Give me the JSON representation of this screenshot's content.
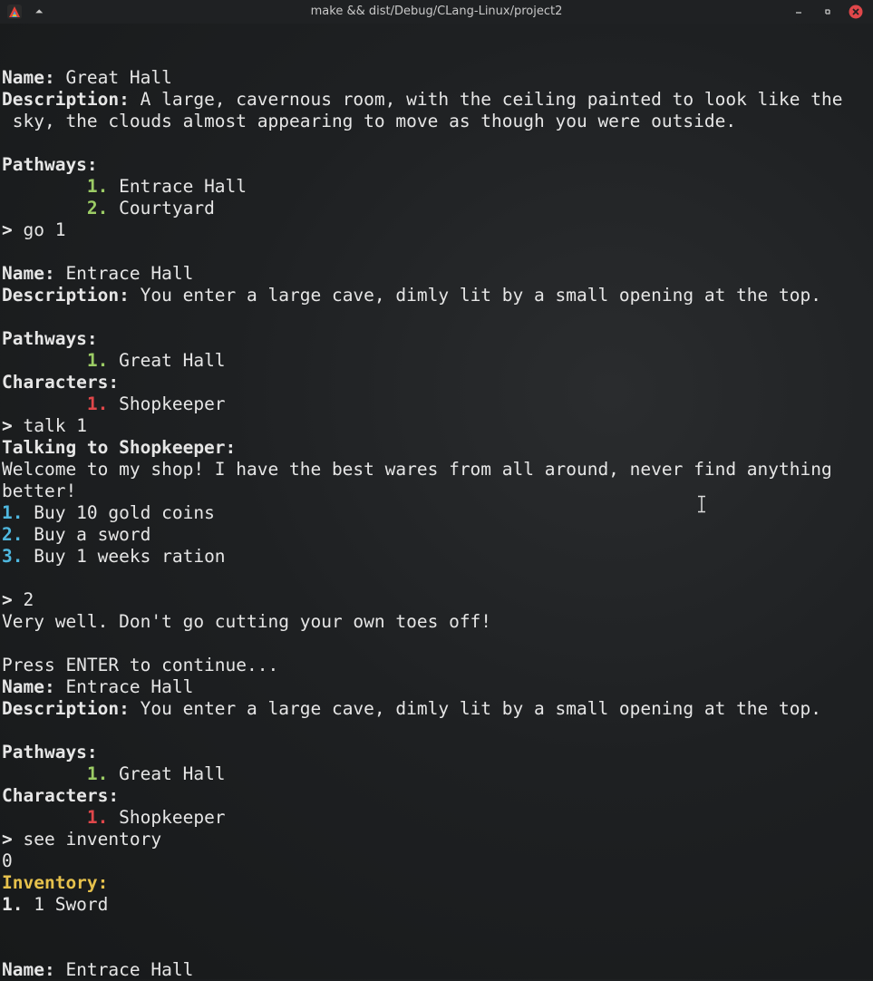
{
  "window": {
    "title": "make && dist/Debug/CLang-Linux/project2",
    "icons": [
      "app-icon",
      "keep-above-icon",
      "minimize-icon",
      "maximize-icon",
      "close-icon"
    ],
    "close_color": "#e0474a"
  },
  "lines": [
    {
      "label": "Name:",
      "text": " Great Hall"
    },
    {
      "label": "Description:",
      "text": " A large, cavernous room, with the ceiling painted to look like the"
    },
    {
      "text": " sky, the clouds almost appearing to move as though you were outside."
    },
    {
      "text": ""
    },
    {
      "label": "Pathways:",
      "text": ""
    },
    {
      "indent": "        ",
      "num": "1.",
      "num_color": "g",
      "text": " Entrace Hall"
    },
    {
      "indent": "        ",
      "num": "2.",
      "num_color": "g",
      "text": " Courtyard"
    },
    {
      "label": ">",
      "text": " go 1"
    },
    {
      "text": ""
    },
    {
      "label": "Name:",
      "text": " Entrace Hall"
    },
    {
      "label": "Description:",
      "text": " You enter a large cave, dimly lit by a small opening at the top."
    },
    {
      "text": ""
    },
    {
      "label": "Pathways:",
      "text": ""
    },
    {
      "indent": "        ",
      "num": "1.",
      "num_color": "g",
      "text": " Great Hall"
    },
    {
      "label": "Characters:",
      "text": ""
    },
    {
      "indent": "        ",
      "num": "1.",
      "num_color": "r",
      "text": " Shopkeeper"
    },
    {
      "label": ">",
      "text": " talk 1"
    },
    {
      "label": "Talking to Shopkeeper:",
      "text": ""
    },
    {
      "text": "Welcome to my shop! I have the best wares from all around, never find anything"
    },
    {
      "text": "better!"
    },
    {
      "num": "1.",
      "num_color": "c",
      "text": " Buy 10 gold coins"
    },
    {
      "num": "2.",
      "num_color": "c",
      "text": " Buy a sword"
    },
    {
      "num": "3.",
      "num_color": "c",
      "text": " Buy 1 weeks ration"
    },
    {
      "text": ""
    },
    {
      "label": ">",
      "text": " 2"
    },
    {
      "text": "Very well. Don't go cutting your own toes off!"
    },
    {
      "text": ""
    },
    {
      "text": "Press ENTER to continue..."
    },
    {
      "label": "Name:",
      "text": " Entrace Hall"
    },
    {
      "label": "Description:",
      "text": " You enter a large cave, dimly lit by a small opening at the top."
    },
    {
      "text": ""
    },
    {
      "label": "Pathways:",
      "text": ""
    },
    {
      "indent": "        ",
      "num": "1.",
      "num_color": "g",
      "text": " Great Hall"
    },
    {
      "label": "Characters:",
      "text": ""
    },
    {
      "indent": "        ",
      "num": "1.",
      "num_color": "r",
      "text": " Shopkeeper"
    },
    {
      "label": ">",
      "text": " see inventory"
    },
    {
      "text": "0"
    },
    {
      "label": "Inventory:",
      "label_color": "y",
      "text": ""
    },
    {
      "label": "1.",
      "text": " 1 Sword"
    },
    {
      "text": ""
    },
    {
      "text": ""
    },
    {
      "label": "Name:",
      "text": " Entrace Hall"
    }
  ]
}
